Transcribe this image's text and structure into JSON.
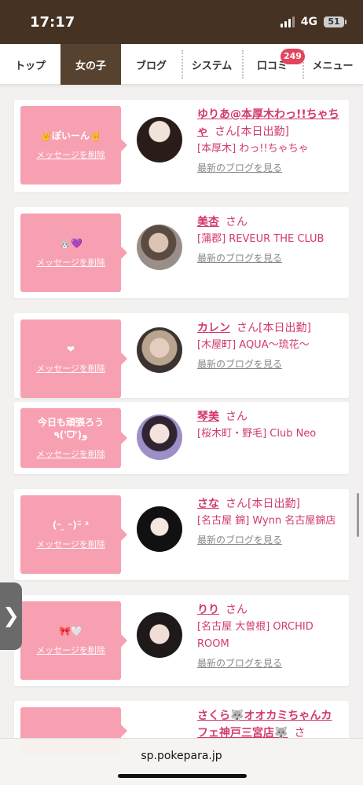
{
  "status": {
    "time": "17:17",
    "network": "4G",
    "battery": "51"
  },
  "nav": {
    "tabs": [
      {
        "label": "トップ"
      },
      {
        "label": "女の子"
      },
      {
        "label": "ブログ"
      },
      {
        "label": "システム"
      },
      {
        "label": "口コミ"
      },
      {
        "label": "メニュー"
      }
    ],
    "badge": "249"
  },
  "girls": [
    {
      "message": "🤘ぽいーん🤘",
      "delete_label": "メッセージを削除",
      "name": "ゆりあ@本厚木わっ!!ちゃちゃ",
      "san": "さん",
      "attendance": "[本日出勤]",
      "shop": "[本厚木] わっ!!ちゃちゃ",
      "blog_link": "最新のブログを見る"
    },
    {
      "message": "🐰💜",
      "delete_label": "メッセージを削除",
      "name": "美杏",
      "san": "さん",
      "attendance": "",
      "shop": "[蒲郡] REVEUR THE CLUB",
      "blog_link": "最新のブログを見る"
    },
    {
      "message": "❤",
      "delete_label": "メッセージを削除",
      "name": "カレン",
      "san": "さん",
      "attendance": "[本日出勤]",
      "shop": "[木屋町] AQUA〜琉花〜",
      "blog_link": "最新のブログを見る"
    },
    {
      "message": "今日も頑張ろう\n٩('ᗜ')و",
      "delete_label": "メッセージを削除",
      "name": "琴美",
      "san": "さん",
      "attendance": "",
      "shop": "[桜木町・野毛] Club Neo",
      "blog_link": ""
    },
    {
      "message": "(ᵕ ̯ ᵕ)ᵕ̈ ³",
      "delete_label": "メッセージを削除",
      "name": "さな",
      "san": "さん",
      "attendance": "[本日出勤]",
      "shop": "[名古屋 錦] Wynn 名古屋錦店",
      "blog_link": "最新のブログを見る"
    },
    {
      "message": "🎀🤍",
      "delete_label": "メッセージを削除",
      "name": "りり",
      "san": "さん",
      "attendance": "",
      "shop": "[名古屋 大曽根] ORCHID ROOM",
      "blog_link": "最新のブログを見る"
    },
    {
      "message": "",
      "delete_label": "",
      "name": "さくら🐺オオカミちゃんカフェ神戸三宮店🐺",
      "san": "さ",
      "attendance": "",
      "shop": "",
      "blog_link": ""
    }
  ],
  "url": "sp.pokepara.jp",
  "colors": {
    "header_bg": "#453222",
    "active_tab": "#56422f",
    "accent_pink": "#f7a0b2",
    "link_pink": "#d23a6a",
    "badge_red": "#e2445c"
  }
}
